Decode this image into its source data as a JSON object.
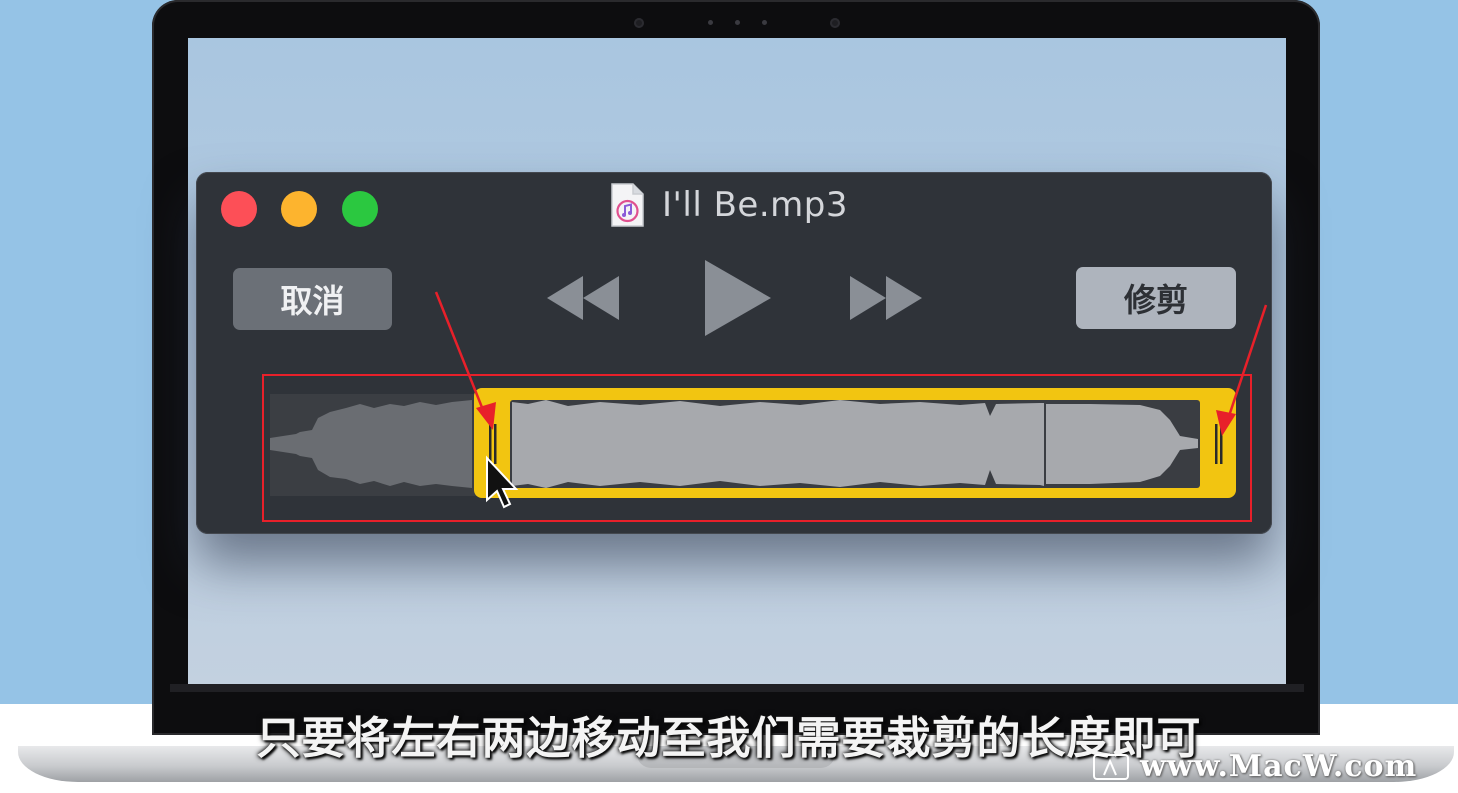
{
  "window": {
    "title": "I'll Be.mp3",
    "file_icon": "itunes-audio-file-icon"
  },
  "buttons": {
    "cancel_label": "取消",
    "trim_label": "修剪"
  },
  "controls": {
    "rewind_icon": "rewind-icon",
    "play_icon": "play-icon",
    "fast_forward_icon": "fast-forward-icon"
  },
  "trim": {
    "selection_start_fraction": 0.22,
    "selection_end_fraction": 0.99
  },
  "colors": {
    "close": "#fd4f57",
    "minimize": "#fdb42e",
    "maximize": "#2bc840",
    "selection": "#f2c511",
    "annotation": "#e8202a"
  },
  "subtitle": "只要将左右两边移动至我们需要裁剪的长度即可",
  "watermark": "www.MacW.com"
}
